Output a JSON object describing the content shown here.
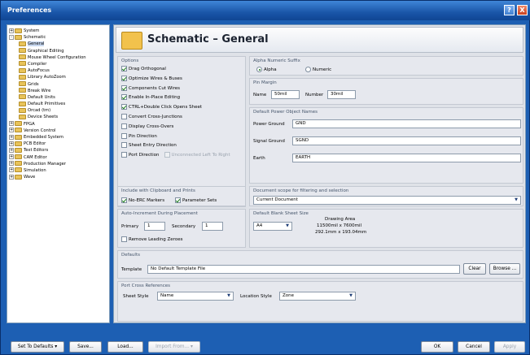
{
  "window": {
    "title": "Preferences",
    "help_label": "?",
    "close_label": "X"
  },
  "tree": [
    {
      "label": "System",
      "pm": "+",
      "level": 0
    },
    {
      "label": "Schematic",
      "pm": "-",
      "level": 0
    },
    {
      "label": "General",
      "pm": "",
      "level": 1,
      "selected": true
    },
    {
      "label": "Graphical Editing",
      "pm": "",
      "level": 1
    },
    {
      "label": "Mouse Wheel Configuration",
      "pm": "",
      "level": 1
    },
    {
      "label": "Compiler",
      "pm": "",
      "level": 1
    },
    {
      "label": "AutoFocus",
      "pm": "",
      "level": 1
    },
    {
      "label": "Library AutoZoom",
      "pm": "",
      "level": 1
    },
    {
      "label": "Grids",
      "pm": "",
      "level": 1
    },
    {
      "label": "Break Wire",
      "pm": "",
      "level": 1
    },
    {
      "label": "Default Units",
      "pm": "",
      "level": 1
    },
    {
      "label": "Default Primitives",
      "pm": "",
      "level": 1
    },
    {
      "label": "Orcad (tm)",
      "pm": "",
      "level": 1
    },
    {
      "label": "Device Sheets",
      "pm": "",
      "level": 1
    },
    {
      "label": "FPGA",
      "pm": "+",
      "level": 0
    },
    {
      "label": "Version Control",
      "pm": "+",
      "level": 0
    },
    {
      "label": "Embedded System",
      "pm": "+",
      "level": 0
    },
    {
      "label": "PCB Editor",
      "pm": "+",
      "level": 0
    },
    {
      "label": "Text Editors",
      "pm": "+",
      "level": 0
    },
    {
      "label": "CAM Editor",
      "pm": "+",
      "level": 0
    },
    {
      "label": "Production Manager",
      "pm": "+",
      "level": 0
    },
    {
      "label": "Simulation",
      "pm": "+",
      "level": 0
    },
    {
      "label": "Wave",
      "pm": "+",
      "level": 0
    }
  ],
  "header": {
    "title": "Schematic – General"
  },
  "options": {
    "title": "Options",
    "items": [
      {
        "label": "Drag Orthogonal",
        "checked": true
      },
      {
        "label": "Optimize Wires & Buses",
        "checked": true
      },
      {
        "label": "Components Cut Wires",
        "checked": true
      },
      {
        "label": "Enable In-Place Editing",
        "checked": true
      },
      {
        "label": "CTRL+Double Click Opens Sheet",
        "checked": true
      },
      {
        "label": "Convert Cross-Junctions",
        "checked": false
      },
      {
        "label": "Display Cross-Overs",
        "checked": false
      },
      {
        "label": "Pin Direction",
        "checked": false
      },
      {
        "label": "Sheet Entry Direction",
        "checked": false
      },
      {
        "label": "Port Direction",
        "checked": false
      }
    ],
    "unconnected_label": "Unconnected Left To Right"
  },
  "alpha": {
    "title": "Alpha Numeric Suffix",
    "alpha_label": "Alpha",
    "numeric_label": "Numeric"
  },
  "pin_margin": {
    "title": "Pin Margin",
    "name_label": "Name",
    "name_value": "50mil",
    "number_label": "Number",
    "number_value": "30mil"
  },
  "power": {
    "title": "Default Power Object Names",
    "rows": [
      {
        "label": "Power Ground",
        "value": "GND"
      },
      {
        "label": "Signal Ground",
        "value": "SGND"
      },
      {
        "label": "Earth",
        "value": "EARTH"
      }
    ]
  },
  "clipboard": {
    "title": "Include with Clipboard and Prints",
    "no_erc": "No-ERC Markers",
    "param_sets": "Parameter Sets"
  },
  "doc_scope": {
    "title": "Document scope for filtering and selection",
    "value": "Current Document"
  },
  "auto_inc": {
    "title": "Auto-Increment During Placement",
    "primary_label": "Primary",
    "primary_value": "1",
    "secondary_label": "Secondary",
    "secondary_value": "1",
    "remove_zeroes": "Remove Leading Zeroes"
  },
  "sheet_size": {
    "title": "Default Blank Sheet Size",
    "value": "A4",
    "area_title": "Drawing Area",
    "area_line1": "11500mil x 7600mil",
    "area_line2": "292.1mm x 193.04mm"
  },
  "defaults": {
    "title": "Defaults",
    "template_label": "Template",
    "template_value": "No Default Template File",
    "clear_label": "Clear",
    "browse_label": "Browse ..."
  },
  "port_refs": {
    "title": "Port Cross References",
    "sheet_style_label": "Sheet Style",
    "sheet_style_value": "Name",
    "location_style_label": "Location Style",
    "location_style_value": "Zone"
  },
  "footer": {
    "set_defaults": "Set To Defaults",
    "save": "Save...",
    "load": "Load...",
    "import": "Import From...",
    "ok": "OK",
    "cancel": "Cancel",
    "apply": "Apply"
  }
}
